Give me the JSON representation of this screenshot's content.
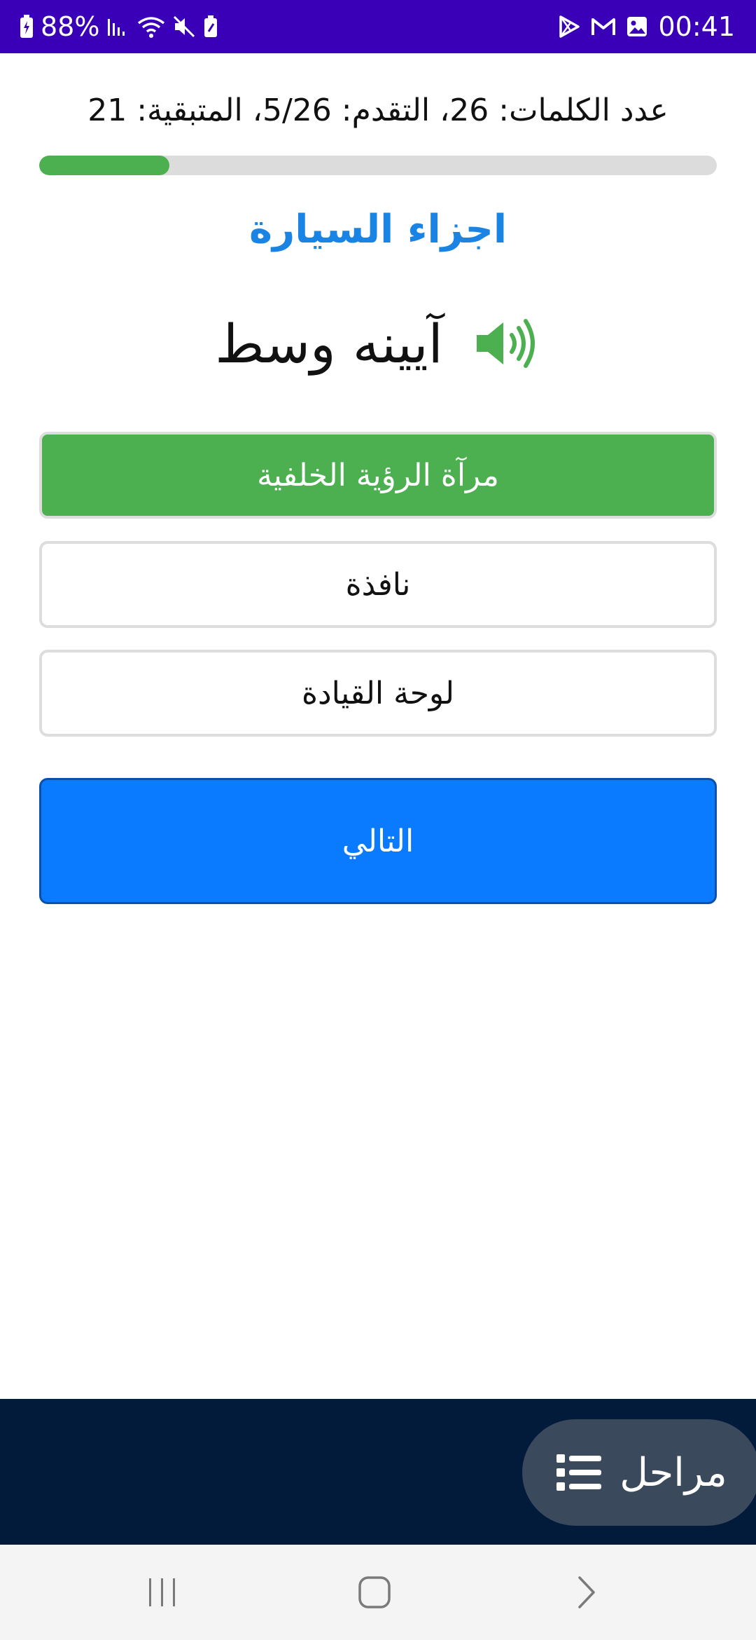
{
  "status_bar": {
    "battery": "88%",
    "time": "00:41"
  },
  "quiz": {
    "summary": "عدد الكلمات: 26، التقدم: 5/26، المتبقية: 21",
    "progress_fraction": 0.192,
    "category_title": "اجزاء السيارة",
    "word": "آيينه وسط",
    "options": [
      {
        "label": "مرآة الرؤية الخلفية",
        "state": "correct"
      },
      {
        "label": "نافذة",
        "state": "default"
      },
      {
        "label": "لوحة القيادة",
        "state": "default"
      }
    ],
    "next_label": "التالي"
  },
  "bottom": {
    "stages_label": "مراحل"
  },
  "colors": {
    "status_bar": "#3a00b8",
    "title_blue": "#1a84e5",
    "correct_green": "#4caf50",
    "next_blue": "#0a7bff",
    "bottom_bar": "#031b3a",
    "stages_button": "#3a4a5c"
  },
  "icons": {
    "speaker": "speaker-volume-icon",
    "stages": "list-icon"
  }
}
